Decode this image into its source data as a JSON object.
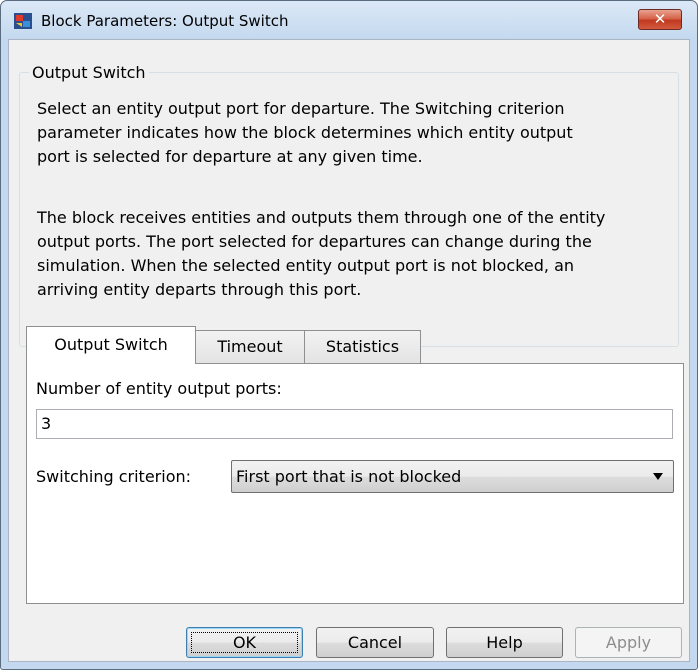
{
  "window": {
    "title": "Block Parameters: Output Switch",
    "close_label": "✕",
    "app_icon": "simulink-block-icon"
  },
  "group": {
    "legend": "Output Switch",
    "description_lines": [
      "Select an entity output port for departure. The Switching criterion",
      "parameter indicates how the block determines which entity output",
      "port is selected for departure at any given time.",
      "The block receives entities and outputs them through one of the entity",
      "output ports. The port selected for departures can change during the",
      "simulation. When the selected entity output port is not blocked, an",
      "arriving entity departs through this port."
    ]
  },
  "tabs": [
    {
      "label": "Output Switch",
      "active": true
    },
    {
      "label": "Timeout",
      "active": false
    },
    {
      "label": "Statistics",
      "active": false
    }
  ],
  "form": {
    "ports_label": "Number of entity output ports:",
    "ports_value": "3",
    "criterion_label": "Switching criterion:",
    "criterion_value": "First port that is not blocked"
  },
  "buttons": {
    "ok": "OK",
    "cancel": "Cancel",
    "help": "Help",
    "apply": "Apply"
  },
  "colors": {
    "title_gradient_top": "#dbe8f6",
    "close_button": "#c0391f",
    "dialog_background": "#f0f0f0"
  }
}
